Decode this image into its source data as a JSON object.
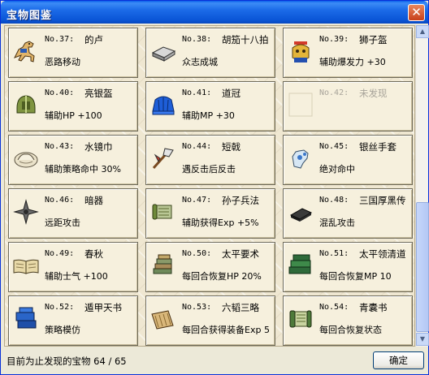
{
  "window": {
    "title": "宝物图鉴",
    "close_glyph": "✕"
  },
  "items": [
    {
      "num": "No.37:",
      "name": "的卢",
      "desc": "恶路移动",
      "icon": "horse-icon"
    },
    {
      "num": "No.38:",
      "name": "胡笳十八拍",
      "desc": "众志成城",
      "icon": "scroll-case-icon"
    },
    {
      "num": "No.39:",
      "name": "狮子盔",
      "desc": "辅助爆发力 +30",
      "icon": "lion-helmet-icon"
    },
    {
      "num": "No.40:",
      "name": "亮银盔",
      "desc": "辅助HP +100",
      "icon": "silver-helmet-icon"
    },
    {
      "num": "No.41:",
      "name": "道冠",
      "desc": "辅助MP +30",
      "icon": "taoist-cap-icon"
    },
    {
      "num": "No.42:",
      "name": "未发现",
      "desc": "",
      "icon": "empty-slot",
      "undiscovered": true
    },
    {
      "num": "No.43:",
      "name": "水镜巾",
      "desc": "辅助策略命中 30%",
      "icon": "headscarf-icon"
    },
    {
      "num": "No.44:",
      "name": "短戟",
      "desc": "遇反击后反击",
      "icon": "halberd-icon"
    },
    {
      "num": "No.45:",
      "name": "银丝手套",
      "desc": "绝对命中",
      "icon": "glove-icon"
    },
    {
      "num": "No.46:",
      "name": "暗器",
      "desc": "远距攻击",
      "icon": "shuriken-icon"
    },
    {
      "num": "No.47:",
      "name": "孙子兵法",
      "desc": "辅助获得Exp +5%",
      "icon": "scroll-icon"
    },
    {
      "num": "No.48:",
      "name": "三国厚黑传",
      "desc": "混乱攻击",
      "icon": "black-book-icon"
    },
    {
      "num": "No.49:",
      "name": "春秋",
      "desc": "辅助士气 +100",
      "icon": "open-book-icon"
    },
    {
      "num": "No.50:",
      "name": "太平要术",
      "desc": "每回合恢复HP 20%",
      "icon": "book-stack-icon"
    },
    {
      "num": "No.51:",
      "name": "太平领清道",
      "desc": "每回合恢复MP 10",
      "icon": "green-books-icon"
    },
    {
      "num": "No.52:",
      "name": "遁甲天书",
      "desc": "策略模仿",
      "icon": "blue-book-icon"
    },
    {
      "num": "No.53:",
      "name": "六韬三略",
      "desc": "每回合获得装备Exp 5",
      "icon": "bamboo-scroll-icon"
    },
    {
      "num": "No.54:",
      "name": "青囊书",
      "desc": "每回合恢复状态",
      "icon": "green-scroll-icon"
    }
  ],
  "status": {
    "text": "目前为止发现的宝物 64 / 65"
  },
  "ok_button": {
    "label": "确定"
  },
  "scrollbar": {
    "up_glyph": "▲",
    "down_glyph": "▼"
  }
}
